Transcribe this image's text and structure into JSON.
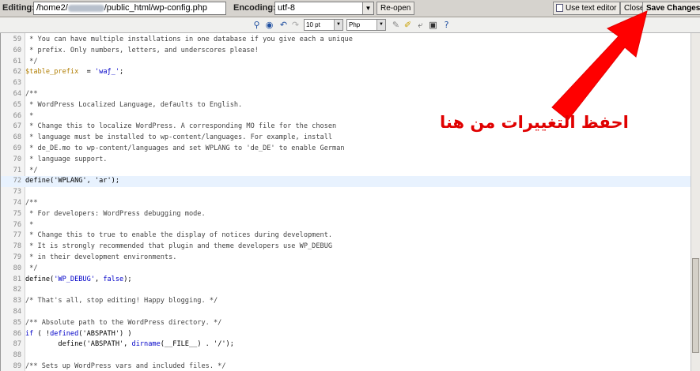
{
  "topbar": {
    "editing_label": "Editing:",
    "path_prefix": "/home2/",
    "path_suffix": "/public_html/wp-config.php",
    "encoding_label": "Encoding:",
    "encoding_value": "utf-8",
    "reopen_label": "Re-open",
    "text_editor_label": "Use text editor",
    "close_label": "Close",
    "save_label": "Save Changes"
  },
  "toolbar": {
    "font_size": "10 pt",
    "syntax": "Php"
  },
  "editor": {
    "lines": [
      {
        "n": "59",
        "t": " * You can have multiple installations in one database if you give each a unique",
        "k": "com"
      },
      {
        "n": "60",
        "t": " * prefix. Only numbers, letters, and underscores please!",
        "k": "com"
      },
      {
        "n": "61",
        "t": " */",
        "k": "com"
      },
      {
        "n": "62",
        "t": "",
        "k": "prefix"
      },
      {
        "n": "63",
        "t": "",
        "k": "blank"
      },
      {
        "n": "64",
        "t": "/**",
        "k": "com"
      },
      {
        "n": "65",
        "t": " * WordPress Localized Language, defaults to English.",
        "k": "com"
      },
      {
        "n": "66",
        "t": " *",
        "k": "com"
      },
      {
        "n": "67",
        "t": " * Change this to localize WordPress. A corresponding MO file for the chosen",
        "k": "com"
      },
      {
        "n": "68",
        "t": " * language must be installed to wp-content/languages. For example, install",
        "k": "com"
      },
      {
        "n": "69",
        "t": " * de_DE.mo to wp-content/languages and set WPLANG to 'de_DE' to enable German",
        "k": "com"
      },
      {
        "n": "70",
        "t": " * language support.",
        "k": "com"
      },
      {
        "n": "71",
        "t": " */",
        "k": "com"
      },
      {
        "n": "72",
        "t": "define('WPLANG', 'ar');",
        "k": "def",
        "hl": true
      },
      {
        "n": "73",
        "t": "",
        "k": "blank"
      },
      {
        "n": "74",
        "t": "/**",
        "k": "com"
      },
      {
        "n": "75",
        "t": " * For developers: WordPress debugging mode.",
        "k": "com"
      },
      {
        "n": "76",
        "t": " *",
        "k": "com"
      },
      {
        "n": "77",
        "t": " * Change this to true to enable the display of notices during development.",
        "k": "com"
      },
      {
        "n": "78",
        "t": " * It is strongly recommended that plugin and theme developers use WP_DEBUG",
        "k": "com"
      },
      {
        "n": "79",
        "t": " * in their development environments.",
        "k": "com"
      },
      {
        "n": "80",
        "t": " */",
        "k": "com"
      },
      {
        "n": "81",
        "t": "",
        "k": "debug"
      },
      {
        "n": "82",
        "t": "",
        "k": "blank"
      },
      {
        "n": "83",
        "t": "/* That's all, stop editing! Happy blogging. */",
        "k": "com"
      },
      {
        "n": "84",
        "t": "",
        "k": "blank"
      },
      {
        "n": "85",
        "t": "/** Absolute path to the WordPress directory. */",
        "k": "com"
      },
      {
        "n": "86",
        "t": "",
        "k": "if"
      },
      {
        "n": "87",
        "t": "",
        "k": "abspath"
      },
      {
        "n": "88",
        "t": "",
        "k": "blank"
      },
      {
        "n": "89",
        "t": "/** Sets up WordPress vars and included files. */",
        "k": "com"
      }
    ],
    "tokens": {
      "prefix_var": "$table_prefix",
      "prefix_eq": "  = ",
      "prefix_val": "'waƒ_'",
      "prefix_end": ";",
      "debug_fn": "define(",
      "debug_key": "'WP_DEBUG'",
      "debug_mid": ", ",
      "debug_val": "false",
      "debug_end": ");",
      "if_kw": "if",
      "if_mid": " ( !",
      "if_fn": "defined",
      "if_arg": "('ABSPATH')",
      "if_end": " )",
      "abs_pre": "        define('ABSPATH', ",
      "abs_fn": "dirname",
      "abs_arg": "(__FILE__)",
      "abs_end": " . '/');"
    }
  },
  "overlay": {
    "text": "احفظ التغييرات من هنا"
  }
}
